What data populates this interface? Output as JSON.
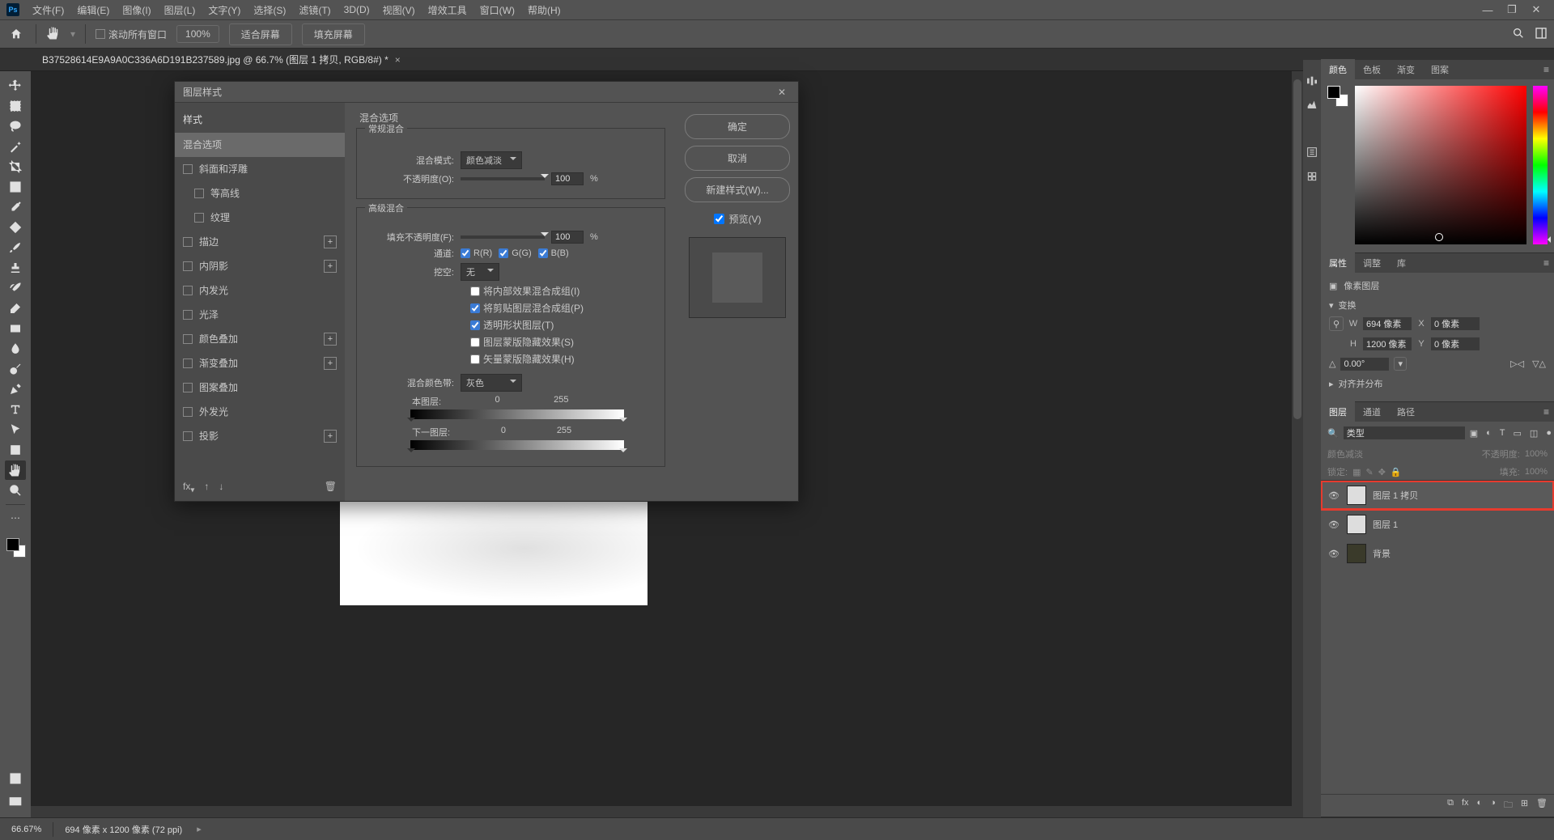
{
  "menubar": [
    "文件(F)",
    "编辑(E)",
    "图像(I)",
    "图层(L)",
    "文字(Y)",
    "选择(S)",
    "滤镜(T)",
    "3D(D)",
    "视图(V)",
    "增效工具",
    "窗口(W)",
    "帮助(H)"
  ],
  "optbar": {
    "scroll_all": "滚动所有窗口",
    "zoom": "100%",
    "fit": "适合屏幕",
    "fill": "填充屏幕"
  },
  "doc_tab": "B37528614E9A9A0C336A6D191B237589.jpg @ 66.7% (图层 1 拷贝, RGB/8#) *",
  "dialog": {
    "title": "图层样式",
    "left_header": "样式",
    "styles": {
      "blend_options": "混合选项",
      "bevel": "斜面和浮雕",
      "contour": "等高线",
      "texture": "纹理",
      "stroke": "描边",
      "inner_shadow": "内阴影",
      "inner_glow": "内发光",
      "satin": "光泽",
      "color_overlay": "颜色叠加",
      "gradient_overlay": "渐变叠加",
      "pattern_overlay": "图案叠加",
      "outer_glow": "外发光",
      "drop_shadow": "投影"
    },
    "mid": {
      "section_title": "混合选项",
      "general_blend": "常规混合",
      "blend_mode_label": "混合模式:",
      "blend_mode_value": "颜色减淡",
      "opacity_label": "不透明度(O):",
      "opacity_value": "100",
      "advanced_blend": "高级混合",
      "fill_opacity_label": "填充不透明度(F):",
      "fill_opacity_value": "100",
      "channels_label": "通道:",
      "ch_r": "R(R)",
      "ch_g": "G(G)",
      "ch_b": "B(B)",
      "knockout_label": "挖空:",
      "knockout_value": "无",
      "adv_opts": {
        "a": "将内部效果混合成组(I)",
        "b": "将剪贴图层混合成组(P)",
        "c": "透明形状图层(T)",
        "d": "图层蒙版隐藏效果(S)",
        "e": "矢量蒙版隐藏效果(H)"
      },
      "blend_if_label": "混合颜色带:",
      "blend_if_value": "灰色",
      "this_layer": "本图层:",
      "this_lo": "0",
      "this_hi": "255",
      "under_layer": "下一图层:",
      "under_lo": "0",
      "under_hi": "255",
      "percent": "%"
    },
    "right": {
      "ok": "确定",
      "cancel": "取消",
      "new_style": "新建样式(W)...",
      "preview": "预览(V)"
    }
  },
  "panels": {
    "color_tabs": [
      "颜色",
      "色板",
      "渐变",
      "图案"
    ],
    "prop_tabs": [
      "属性",
      "调整",
      "库"
    ],
    "prop": {
      "kind": "像素图层",
      "transform": "变换",
      "w_label": "W",
      "w": "694 像素",
      "x_label": "X",
      "x": "0 像素",
      "h_label": "H",
      "h": "1200 像素",
      "y_label": "Y",
      "y": "0 像素",
      "angle": "0.00°",
      "align": "对齐并分布"
    },
    "layer_tabs": [
      "图层",
      "通道",
      "路径"
    ],
    "layers": {
      "kind_filter": "类型",
      "blend_mode": "颜色减淡",
      "opacity_label": "不透明度:",
      "opacity": "100%",
      "fill_label": "填充:",
      "fill": "100%",
      "lock_label": "锁定:",
      "rows": [
        {
          "name": "图层 1 拷贝",
          "sel": true,
          "hl": true
        },
        {
          "name": "图层 1",
          "sel": false,
          "hl": false
        },
        {
          "name": "背景",
          "sel": false,
          "hl": false
        }
      ]
    }
  },
  "status": {
    "zoom": "66.67%",
    "doc": "694 像素 x 1200 像素 (72 ppi)"
  }
}
